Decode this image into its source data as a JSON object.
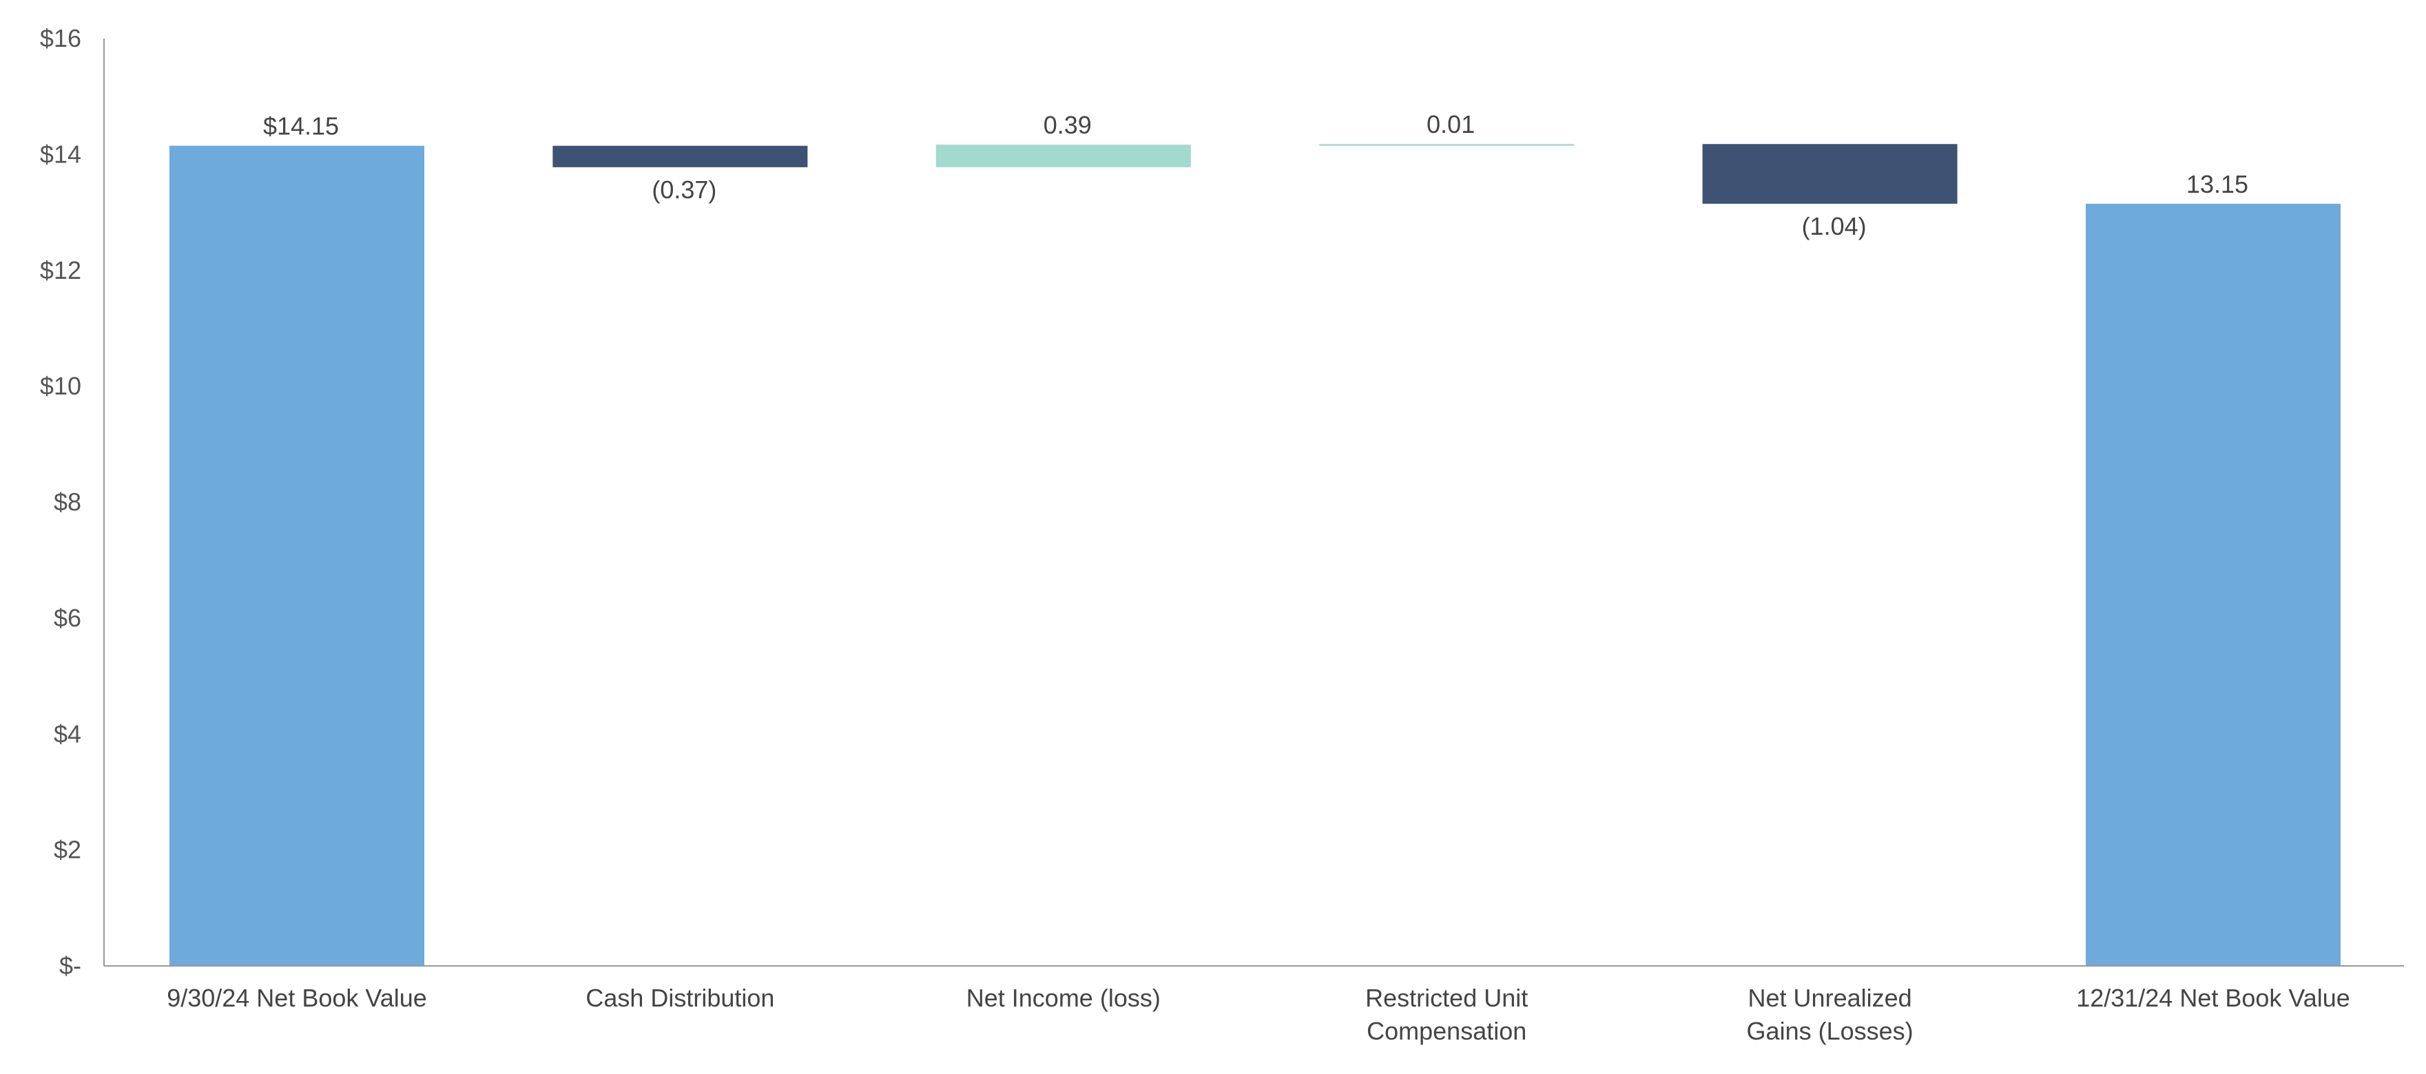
{
  "chart_data": {
    "type": "bar",
    "subtype": "waterfall",
    "title": "",
    "xlabel": "",
    "ylabel": "",
    "ylim": [
      0,
      16
    ],
    "y_ticks": [
      {
        "value": 0,
        "label": "$-"
      },
      {
        "value": 2,
        "label": "$2"
      },
      {
        "value": 4,
        "label": "$4"
      },
      {
        "value": 6,
        "label": "$6"
      },
      {
        "value": 8,
        "label": "$8"
      },
      {
        "value": 10,
        "label": "$10"
      },
      {
        "value": 12,
        "label": "$12"
      },
      {
        "value": 14,
        "label": "$14"
      },
      {
        "value": 16,
        "label": "$16"
      }
    ],
    "grid": false,
    "legend": "none",
    "colors": {
      "total": "#6eaadc",
      "decrease": "#3e5374",
      "increase": "#a3dad0",
      "axis": "#999999"
    },
    "bars": [
      {
        "category": [
          "9/30/24 Net Book Value"
        ],
        "kind": "total",
        "start": 0,
        "end": 14.15,
        "label": "$14.15",
        "label_position": "above"
      },
      {
        "category": [
          "Cash Distribution"
        ],
        "kind": "decrease",
        "start": 14.15,
        "end": 13.78,
        "label": "(0.37)",
        "label_position": "below"
      },
      {
        "category": [
          "Net Income (loss)"
        ],
        "kind": "increase",
        "start": 13.78,
        "end": 14.17,
        "label": "0.39",
        "label_position": "above"
      },
      {
        "category": [
          "Restricted Unit",
          "Compensation"
        ],
        "kind": "increase",
        "start": 14.17,
        "end": 14.18,
        "label": "0.01",
        "label_position": "above"
      },
      {
        "category": [
          "Net Unrealized",
          "Gains (Losses)"
        ],
        "kind": "decrease",
        "start": 14.18,
        "end": 13.15,
        "label": "(1.04)",
        "label_position": "below"
      },
      {
        "category": [
          "12/31/24 Net Book Value"
        ],
        "kind": "total",
        "start": 0,
        "end": 13.15,
        "label": "13.15",
        "label_position": "above"
      }
    ]
  }
}
